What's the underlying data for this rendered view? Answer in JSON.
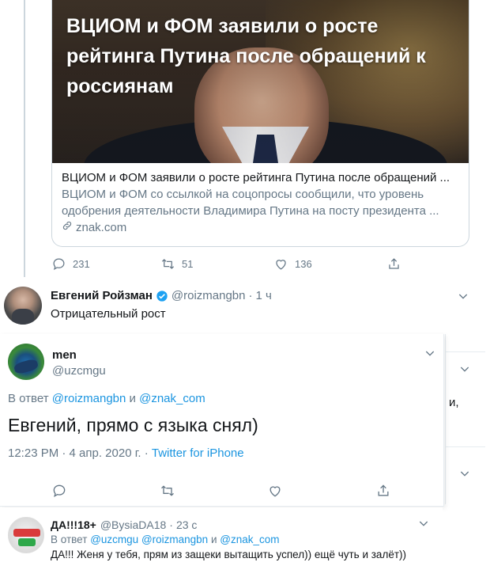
{
  "card": {
    "overlay_title": "ВЦИОМ и ФОМ заявили о росте рейтинга Путина после обращений к россиянам",
    "headline": "ВЦИОМ и ФОМ заявили о росте рейтинга Путина после обращений ...",
    "description": "ВЦИОМ и ФОМ со ссылкой на соцопросы сообщили, что уровень одобрения деятельности Владимира Путина на посту президента ...",
    "domain": "znak.com"
  },
  "top_actions": {
    "replies": "231",
    "retweets": "51",
    "likes": "136"
  },
  "reply1": {
    "name": "Евгений Ройзман",
    "handle": "@roizmangbn",
    "separator": "·",
    "time": "1 ч",
    "text": "Отрицательный рост"
  },
  "popup": {
    "name": "men",
    "handle": "@uzcmgu",
    "reply_prefix": "В ответ",
    "reply_user1": "@roizmangbn",
    "reply_and": "и",
    "reply_user2": "@znak_com",
    "text": "Евгений, прямо с языка снял)",
    "time": "12:23 PM · 4 апр. 2020 г. · ",
    "source": "Twitter for iPhone"
  },
  "background_fragment": "и,",
  "reply2": {
    "name": "ДА!!!18+",
    "handle": "@BysiaDA18",
    "separator": "·",
    "time": "23 с",
    "reply_prefix": "В ответ",
    "reply_user1": "@uzcmgu",
    "reply_user2": "@roizmangbn",
    "reply_and": "и",
    "reply_user3": "@znak_com",
    "text": "ДА!!! Женя у тебя, прям из защеки вытащить успел)) ещё чуть и залёт))"
  },
  "colors": {
    "accent": "#1b95e0",
    "muted": "#657786",
    "text": "#14171a",
    "border": "#e6ecf0"
  },
  "icons": [
    "reply-icon",
    "retweet-icon",
    "like-icon",
    "share-icon",
    "verified-icon",
    "chevron-down-icon",
    "link-icon"
  ]
}
